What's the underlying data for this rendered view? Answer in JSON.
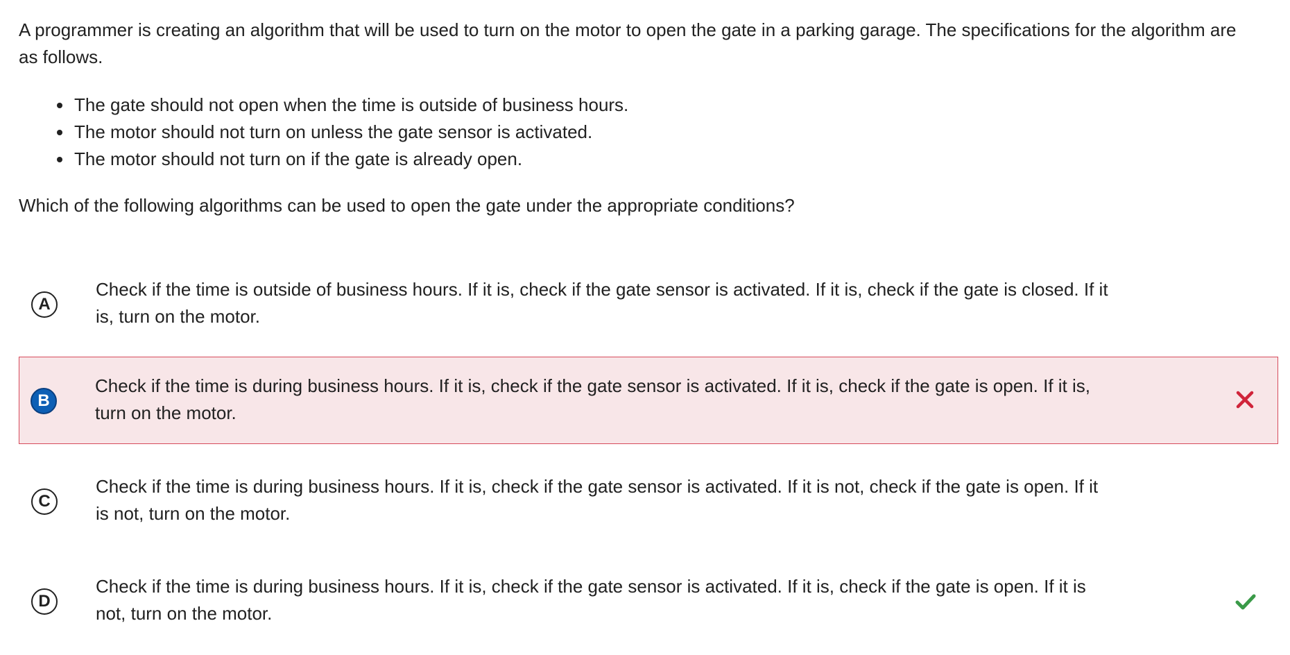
{
  "stem": {
    "intro": "A programmer is creating an algorithm that will be used to turn on the motor to open the gate in a parking garage. The specifications for the algorithm are as follows.",
    "bullets": [
      "The gate should not open when the time is outside of business hours.",
      "The motor should not turn on unless the gate sensor is activated.",
      "The motor should not turn on if the gate is already open."
    ],
    "question": "Which of the following algorithms can be used to open the gate under the appropriate conditions?"
  },
  "choices": [
    {
      "letter": "A",
      "text": "Check if the time is outside of business hours. If it is, check if the gate sensor is activated. If it is, check if the gate is closed. If it is, turn on the motor.",
      "state": "default"
    },
    {
      "letter": "B",
      "text": "Check if the time is during business hours. If it is, check if the gate sensor is activated. If it is, check if the gate is open. If it is, turn on the motor.",
      "state": "selected-incorrect",
      "mark_icon": "x-mark-icon"
    },
    {
      "letter": "C",
      "text": "Check if the time is during business hours. If it is, check if the gate sensor is activated. If it is not, check if the gate is open. If it is not, turn on the motor.",
      "state": "default"
    },
    {
      "letter": "D",
      "text": "Check if the time is during business hours. If it is, check if the gate sensor is activated. If it is, check if the gate is open. If it is not, turn on the motor.",
      "state": "correct",
      "mark_icon": "check-mark-icon"
    }
  ],
  "colors": {
    "selected_background": "#f8e6e8",
    "selected_border": "#d64a5a",
    "selected_letter_fill": "#0d5fb5",
    "incorrect_mark": "#d0243a",
    "correct_mark": "#3a9a48"
  }
}
